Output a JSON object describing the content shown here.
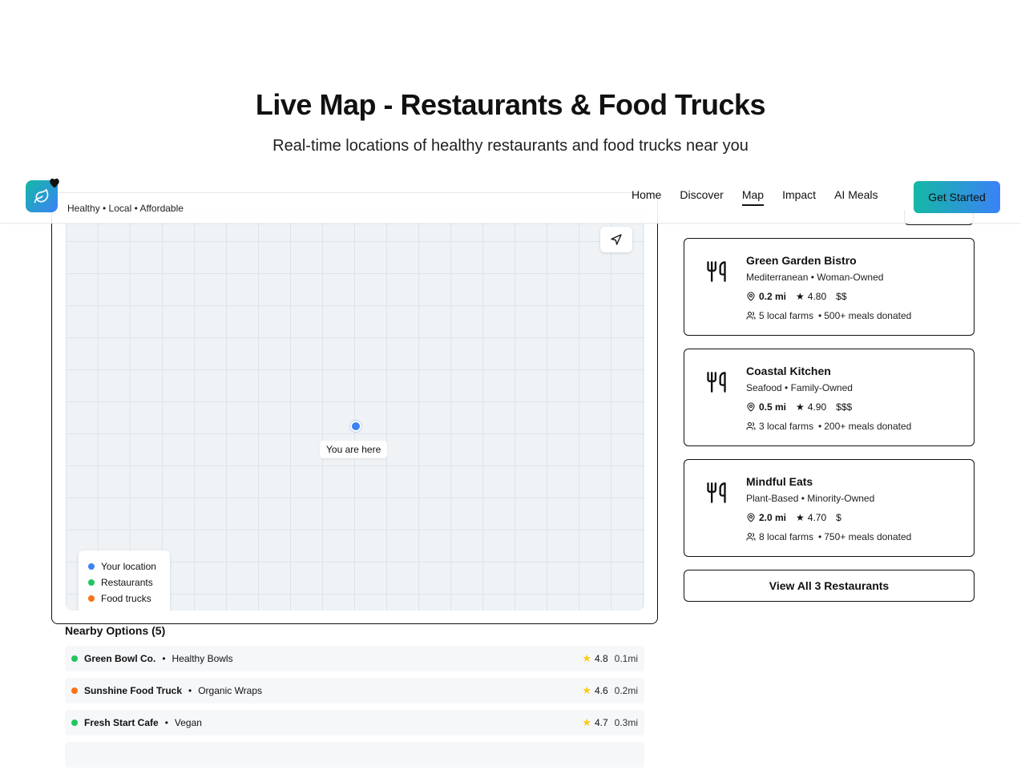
{
  "hero": {
    "title": "Live Map - Restaurants & Food Trucks",
    "subtitle": "Real-time locations of healthy restaurants and food trucks near you"
  },
  "navbar": {
    "tagline": "Healthy • Local • Affordable",
    "links": [
      "Home",
      "Discover",
      "Map",
      "Impact",
      "AI Meals"
    ],
    "active_link": "Map",
    "cta_label": "Get Started"
  },
  "map": {
    "user_label": "You are here",
    "legend": [
      {
        "label": "Your location",
        "color": "#3b82f6"
      },
      {
        "label": "Restaurants",
        "color": "#22c55e"
      },
      {
        "label": "Food trucks",
        "color": "#f97316"
      }
    ]
  },
  "nearby": {
    "title": "Nearby Options (5)",
    "items": [
      {
        "name": "Green Bowl Co.",
        "category": "Healthy Bowls",
        "rating": "4.8",
        "distance": "0.1mi",
        "color": "#22c55e"
      },
      {
        "name": "Sunshine Food Truck",
        "category": "Organic Wraps",
        "rating": "4.6",
        "distance": "0.2mi",
        "color": "#f97316"
      },
      {
        "name": "Fresh Start Cafe",
        "category": "Vegan",
        "rating": "4.7",
        "distance": "0.3mi",
        "color": "#22c55e"
      }
    ]
  },
  "restaurants": {
    "cards": [
      {
        "name": "Green Garden Bistro",
        "cuisine": "Mediterranean",
        "ownership": "Woman-Owned",
        "distance": "0.2 mi",
        "rating": "4.80",
        "price": "$$",
        "farms": "5 local farms",
        "donated": "500+ meals donated"
      },
      {
        "name": "Coastal Kitchen",
        "cuisine": "Seafood",
        "ownership": "Family-Owned",
        "distance": "0.5 mi",
        "rating": "4.90",
        "price": "$$$",
        "farms": "3 local farms",
        "donated": "200+ meals donated"
      },
      {
        "name": "Mindful Eats",
        "cuisine": "Plant-Based",
        "ownership": "Minority-Owned",
        "distance": "2.0 mi",
        "rating": "4.70",
        "price": "$",
        "farms": "8 local farms",
        "donated": "750+ meals donated"
      }
    ],
    "view_all_label": "View All 3 Restaurants"
  },
  "icons": {
    "logo": "leaf-icon",
    "badge": "heart-icon",
    "locate": "navigation-arrow-icon",
    "card": "fork-knife-icon",
    "distance": "map-pin-icon",
    "rating": "star-icon",
    "farms": "users-icon"
  }
}
